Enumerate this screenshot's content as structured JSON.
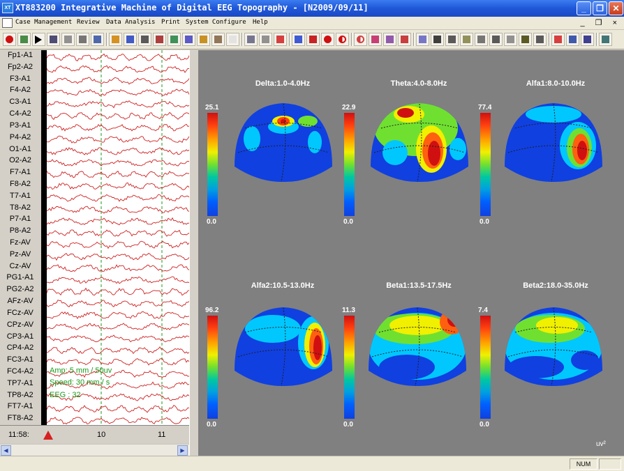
{
  "window": {
    "title": "XT883200 Integrative Machine of Digital EEG Topography - [N2009/09/11]",
    "icon_text": "XT",
    "controls": [
      "_",
      "❐",
      "✕"
    ]
  },
  "menubar": {
    "items": [
      "Case Management",
      "Review",
      "Data Analysis",
      "Print",
      "System Configure",
      "Help"
    ],
    "mdi_controls": "_ ❐ ×"
  },
  "toolbar": {
    "icons": [
      "record-icon",
      "save-icon",
      "play-icon",
      "monitor-icon",
      "stop-icon",
      "square-icon",
      "waveform-icon",
      "colorwheel-icon",
      "spectrum-icon",
      "hz-icon",
      "crosshair-icon",
      "head-icon",
      "channel-icon",
      "bar-icon",
      "calendar-icon",
      "marker-icon",
      "zoom-icon",
      "print-icon",
      "pointer-icon",
      "arrows-icon",
      "delete-icon",
      "redcircle-icon",
      "halfcircle-icon",
      "piecircle-icon",
      "alpha-icon",
      "filter-icon",
      "cross-icon",
      "wave-icon",
      "disk-icon",
      "printer-icon",
      "preview-icon",
      "page-icon",
      "bookmark-icon",
      "book-icon",
      "help-icon",
      "tools-icon",
      "select-icon",
      "export-icon",
      "list-icon",
      "window-icon"
    ]
  },
  "channels": [
    "Fp1-A1",
    "Fp2-A2",
    "F3-A1",
    "F4-A2",
    "C3-A1",
    "C4-A2",
    "P3-A1",
    "P4-A2",
    "O1-A1",
    "O2-A2",
    "F7-A1",
    "F8-A2",
    "T7-A1",
    "T8-A2",
    "P7-A1",
    "P8-A2",
    "Fz-AV",
    "Pz-AV",
    "Cz-AV",
    "PG1-A1",
    "PG2-A2",
    "AFz-AV",
    "FCz-AV",
    "CPz-AV",
    "CP3-A1",
    "CP4-A2",
    "FC3-A1",
    "FC4-A2",
    "TP7-A1",
    "TP8-A2",
    "FT7-A1",
    "FT8-A2"
  ],
  "eeg_info": {
    "amp": "Amp: 5 mm / 50uv",
    "speed": "Speed: 30 mm / s",
    "eeg": "EEG : 32"
  },
  "timebar": {
    "start": "11:58:",
    "ticks": [
      "10",
      "11"
    ]
  },
  "maps": [
    {
      "title": "Delta:1.0-4.0Hz",
      "max": "25.1",
      "min": "0.0"
    },
    {
      "title": "Theta:4.0-8.0Hz",
      "max": "22.9",
      "min": "0.0"
    },
    {
      "title": "Alfa1:8.0-10.0Hz",
      "max": "77.4",
      "min": "0.0"
    },
    {
      "title": "Alfa2:10.5-13.0Hz",
      "max": "96.2",
      "min": "0.0"
    },
    {
      "title": "Beta1:13.5-17.5Hz",
      "max": "11.3",
      "min": "0.0"
    },
    {
      "title": "Beta2:18.0-35.0Hz",
      "max": "7.4",
      "min": "0.0"
    }
  ],
  "unit": "uv²",
  "status": {
    "mode": "NUM"
  }
}
